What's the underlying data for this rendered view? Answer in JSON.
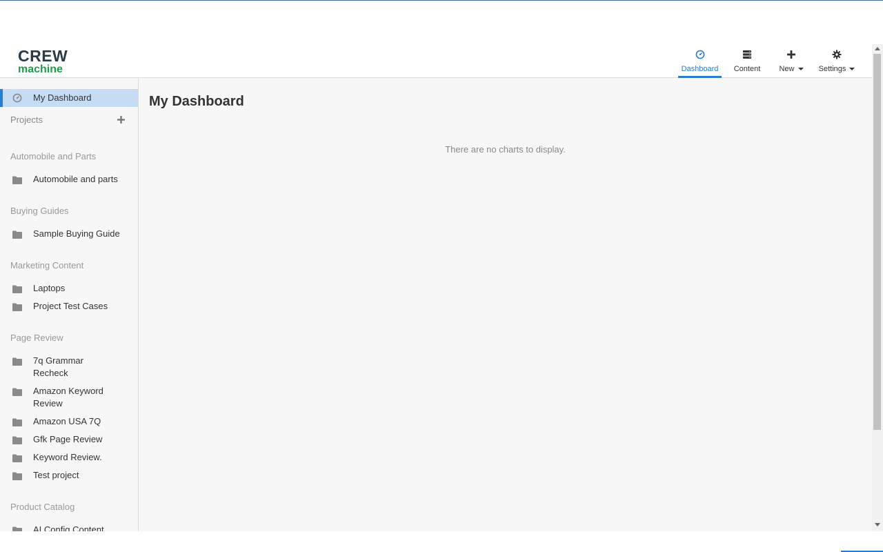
{
  "app": {
    "logo_line1": "CREW",
    "logo_line2": "machine"
  },
  "nav": {
    "dashboard_label": "Dashboard",
    "content_label": "Content",
    "new_label": "New",
    "settings_label": "Settings"
  },
  "sidebar": {
    "dashboard_label": "My Dashboard",
    "projects_label": "Projects",
    "groups": [
      {
        "title": "Automobile and Parts",
        "items": [
          "Automobile and parts"
        ]
      },
      {
        "title": "Buying Guides",
        "items": [
          "Sample Buying Guide"
        ]
      },
      {
        "title": "Marketing Content",
        "items": [
          "Laptops",
          "Project Test Cases"
        ]
      },
      {
        "title": "Page Review",
        "items": [
          "7q Grammar Recheck",
          "Amazon Keyword Review",
          "Amazon USA 7Q",
          "Gfk Page Review",
          "Keyword Review.",
          "Test project"
        ]
      },
      {
        "title": "Product Catalog",
        "items": [
          "AI Config Content"
        ]
      }
    ]
  },
  "main": {
    "title": "My Dashboard",
    "empty_message": "There are no charts to display."
  },
  "colors": {
    "accent": "#2a7bd4",
    "logo_dark": "#2b3a47",
    "logo_green": "#1f9b4a",
    "active_bg": "#c6dcf5"
  }
}
